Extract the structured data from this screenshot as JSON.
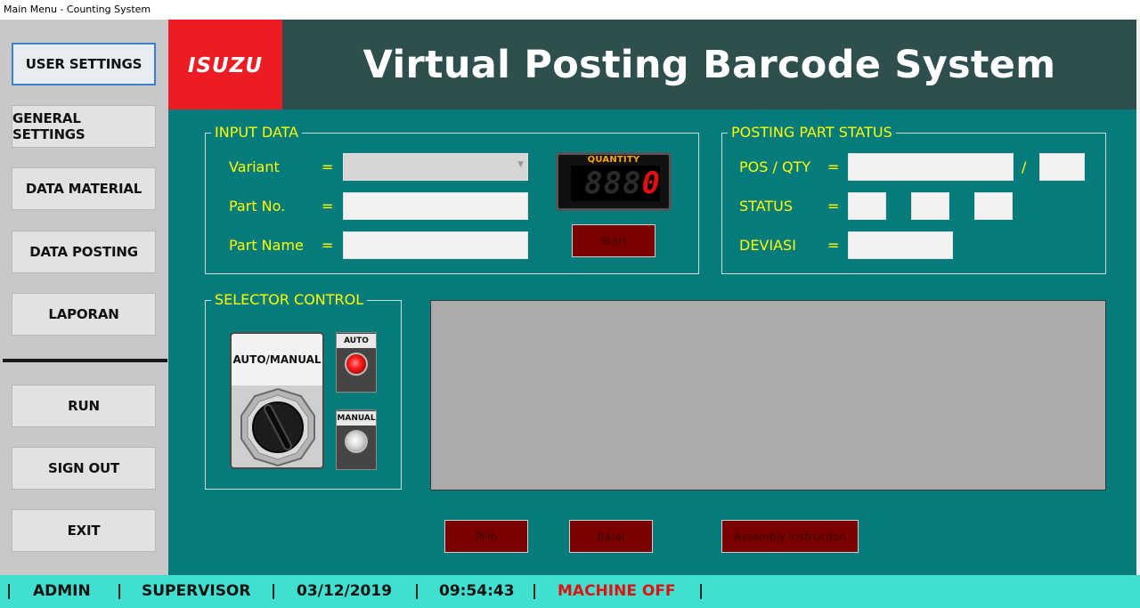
{
  "window": {
    "title": "Main Menu - Counting System"
  },
  "sidebar": {
    "items": [
      {
        "label": "USER SETTINGS"
      },
      {
        "label": "GENERAL SETTINGS"
      },
      {
        "label": "DATA MATERIAL"
      },
      {
        "label": "DATA POSTING"
      },
      {
        "label": "LAPORAN"
      },
      {
        "label": "RUN"
      },
      {
        "label": "SIGN OUT"
      },
      {
        "label": "EXIT"
      }
    ]
  },
  "header": {
    "logo_text": "ISUZU",
    "title": "Virtual Posting Barcode System"
  },
  "input_data": {
    "title": "INPUT DATA",
    "variant_label": "Variant",
    "part_no_label": "Part No.",
    "part_name_label": "Part Name",
    "equals": "=",
    "quantity_label": "QUANTITY",
    "quantity_ghost": "888",
    "quantity_value": "0",
    "start_label": "Start"
  },
  "posting_status": {
    "title": "POSTING PART STATUS",
    "pos_qty_label": "POS / QTY",
    "slash": "/",
    "status_label": "STATUS",
    "deviasi_label": "DEVIASI",
    "equals": "="
  },
  "selector": {
    "title": "SELECTOR CONTROL",
    "switch_label": "AUTO/MANUAL",
    "auto_label": "AUTO",
    "manual_label": "MANUAL"
  },
  "actions": {
    "pilih": "Pilih",
    "batal": "Batal",
    "assembly": "Assembly Instruction"
  },
  "status_bar": {
    "sep": "|",
    "user": "ADMIN",
    "role": "SUPERVISOR",
    "date": "03/12/2019",
    "time": "09:54:43",
    "machine": "MACHINE OFF"
  },
  "colors": {
    "accent_panel": "#057b7b",
    "header_bg": "#2f4f4f",
    "brand_red": "#ed1c24",
    "label_yellow": "#ffff00",
    "status_bar": "#40e0d0",
    "machine_off": "#e01010"
  }
}
